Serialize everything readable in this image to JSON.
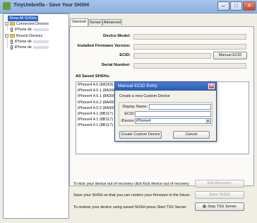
{
  "window": {
    "title": "TinyUmbrella - Save Your SHSH!",
    "controls": {
      "minimize": "–",
      "maximize": "□",
      "close": "✕"
    }
  },
  "sidebar": {
    "items": [
      {
        "label": "Show All SHSHs",
        "selected": true
      },
      {
        "label": "Connected Devices"
      },
      {
        "label": "iPhone de"
      },
      {
        "label": "Recent Devices"
      },
      {
        "label": "iPhone de"
      },
      {
        "label": "iPhone de"
      }
    ]
  },
  "tabs": [
    "General",
    "Server",
    "Advanced"
  ],
  "fields": {
    "device_model": "Device Model:",
    "firmware": "Installed Firmware Version:",
    "ecid": "ECID:",
    "serial": "Serial Number:"
  },
  "buttons": {
    "manual_ecid": "Manual ECID",
    "exit_recovery": "Exit Recovery",
    "save_shsh": "Save SHSH",
    "stop_tss": "Stop TSS Server"
  },
  "saved_shsh": {
    "title": "All Saved SHSHs:",
    "rows": [
      "iPhone4 4.0 (8A293)",
      "iPhone4 4.0.1 (8A306)",
      "iPhone4 4.0.1 (8A306)",
      "iPhone4 4.0.2 (8A400)",
      "iPhone4 4.0.2 (8A400)",
      "iPhone4 4.1 (8B117)",
      "iPhone4 4.1 (8B117)",
      "iPhone4 4.1 (8B117)"
    ]
  },
  "info_lines": {
    "recovery": "To kick your device out of recovery click Kick device out of recovery",
    "save": "Save your SHSH so that you can restore your firmware in the future.",
    "restore": "To restore your device using saved SHSH press Start TSS Server"
  },
  "dialog": {
    "title": "Manual ECID Entry",
    "subtitle": "Create a new Custom Device",
    "display_name_label": "Display Name:",
    "display_name_value": "",
    "ecid_label": "ECID:",
    "ecid_value": "",
    "device_label": "iDevice:",
    "device_value": "iPhone4",
    "create_button": "Create Custom Device",
    "cancel_button": "Cancel",
    "close": "✕"
  },
  "colors": {
    "selection": "#2d63c9",
    "dialog_title": "#2a58b0",
    "close_button": "#c8442b"
  }
}
